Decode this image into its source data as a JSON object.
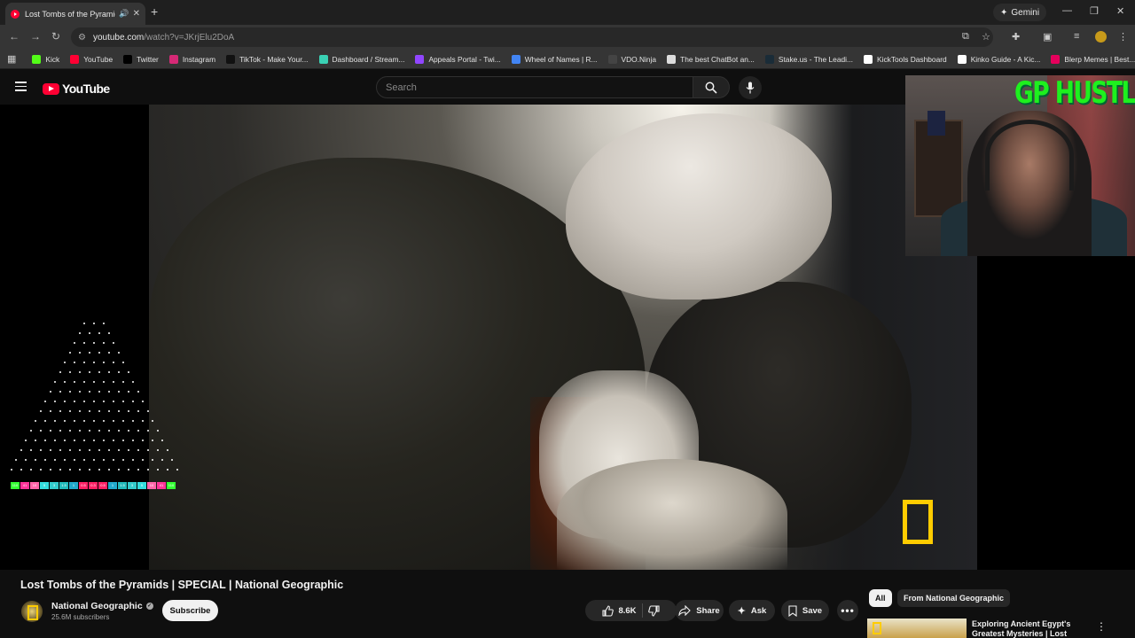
{
  "browser": {
    "tab_title": "Lost Tombs of the Pyramids",
    "new_tab_symbol": "+",
    "gemini_label": "Gemini",
    "url_domain": "youtube.com",
    "url_path": "/watch?v=JKrjElu2DoA"
  },
  "bookmarks": [
    {
      "label": "Kick",
      "color": "#53fc18"
    },
    {
      "label": "YouTube",
      "color": "#ff0033"
    },
    {
      "label": "Twitter",
      "color": "#000000"
    },
    {
      "label": "Instagram",
      "color": "#d62976"
    },
    {
      "label": "TikTok - Make Your...",
      "color": "#111111"
    },
    {
      "label": "Dashboard / Stream...",
      "color": "#3ad1b4"
    },
    {
      "label": "Appeals Portal - Twi...",
      "color": "#9146ff"
    },
    {
      "label": "Wheel of Names | R...",
      "color": "#4285f4"
    },
    {
      "label": "VDO.Ninja",
      "color": "#444444"
    },
    {
      "label": "The best ChatBot an...",
      "color": "#dddddd"
    },
    {
      "label": "Stake.us - The Leadi...",
      "color": "#1a2c38"
    },
    {
      "label": "KickTools Dashboard",
      "color": "#ffffff"
    },
    {
      "label": "Kinko Guide - A Kic...",
      "color": "#ffffff"
    },
    {
      "label": "Blerp Memes | Best...",
      "color": "#e6005c"
    }
  ],
  "youtube": {
    "logo_text": "YouTube",
    "search_placeholder": "Search"
  },
  "stream_overlay": {
    "banner_text": "GP HUSTLA",
    "plinko_multipliers": [
      "110",
      "41",
      "10",
      "5",
      "3",
      "1.5",
      "1",
      "0.5",
      "0.3",
      "0.5",
      "1",
      "1.5",
      "3",
      "5",
      "10",
      "41",
      "110"
    ]
  },
  "video": {
    "title": "Lost Tombs of the Pyramids | SPECIAL | National Geographic",
    "channel_name": "National Geographic",
    "subscribers": "25.6M subscribers",
    "subscribe_label": "Subscribe",
    "likes": "8.6K",
    "share_label": "Share",
    "ask_label": "Ask",
    "save_label": "Save"
  },
  "sidebar": {
    "chips": [
      "All",
      "From National Geographic"
    ],
    "reco_title": "Exploring Ancient Egypt's Greatest Mysteries | Lost"
  },
  "colors": {
    "youtube_red": "#ff0033",
    "natgeo_yellow": "#ffcc00",
    "overlay_green": "#1ef01e"
  }
}
